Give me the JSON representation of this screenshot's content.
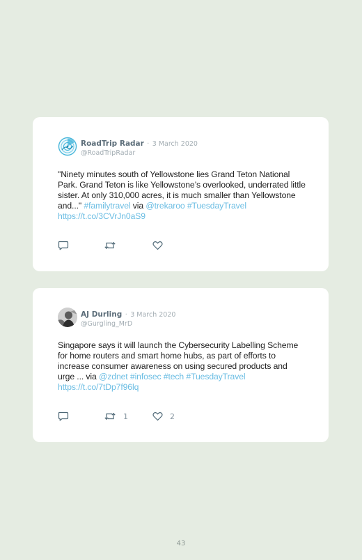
{
  "tweets": [
    {
      "name": "RoadTrip Radar",
      "separator": "·",
      "date": "3 March 2020",
      "handle": "@RoadTripRadar",
      "avatar_icon": "radar-logo-icon",
      "text": [
        {
          "t": "\"Ninety minutes south of Yellowstone lies Grand Teton National Park. Grand Teton is like Yellowstone’s overlooked, underrated little sister. At only 310,000 acres, it is much smaller than Yellowstone and...\" ",
          "link": false
        },
        {
          "t": "#familytravel",
          "link": true
        },
        {
          "t": " via ",
          "link": false
        },
        {
          "t": "@trekaroo",
          "link": true
        },
        {
          "t": " ",
          "link": false
        },
        {
          "t": "#TuesdayTravel",
          "link": true
        },
        {
          "t": " ",
          "link": false
        },
        {
          "t": "https://t.co/3CVrJn0aS9",
          "link": true
        }
      ],
      "actions": {
        "reply_icon": "reply-icon",
        "retweet_icon": "retweet-icon",
        "like_icon": "heart-icon",
        "retweets": "",
        "likes": ""
      }
    },
    {
      "name": "AJ Durling",
      "separator": "·",
      "date": "3 March 2020",
      "handle": "@Gurgling_MrD",
      "avatar_icon": "user-photo-avatar",
      "text": [
        {
          "t": "Singapore says it will launch the Cybersecurity Labelling Scheme for home routers and smart home hubs, as part of efforts to increase consumer awareness on using secured products and urge ... via ",
          "link": false
        },
        {
          "t": "@zdnet",
          "link": true
        },
        {
          "t": " ",
          "link": false
        },
        {
          "t": "#infosec",
          "link": true
        },
        {
          "t": " ",
          "link": false
        },
        {
          "t": "#tech",
          "link": true
        },
        {
          "t": " ",
          "link": false
        },
        {
          "t": "#TuesdayTravel",
          "link": true
        },
        {
          "t": " ",
          "link": false
        },
        {
          "t": "https://t.co/7tDp7f96lq",
          "link": true
        }
      ],
      "actions": {
        "reply_icon": "reply-icon",
        "retweet_icon": "retweet-icon",
        "like_icon": "heart-icon",
        "retweets": "1",
        "likes": "2"
      }
    }
  ],
  "page_number": "43",
  "colors": {
    "background": "#e5ece2",
    "card": "#ffffff",
    "link": "#6bbde3",
    "name": "#5d6e7a",
    "meta": "#a3adb3",
    "icon": "#4d6775"
  }
}
